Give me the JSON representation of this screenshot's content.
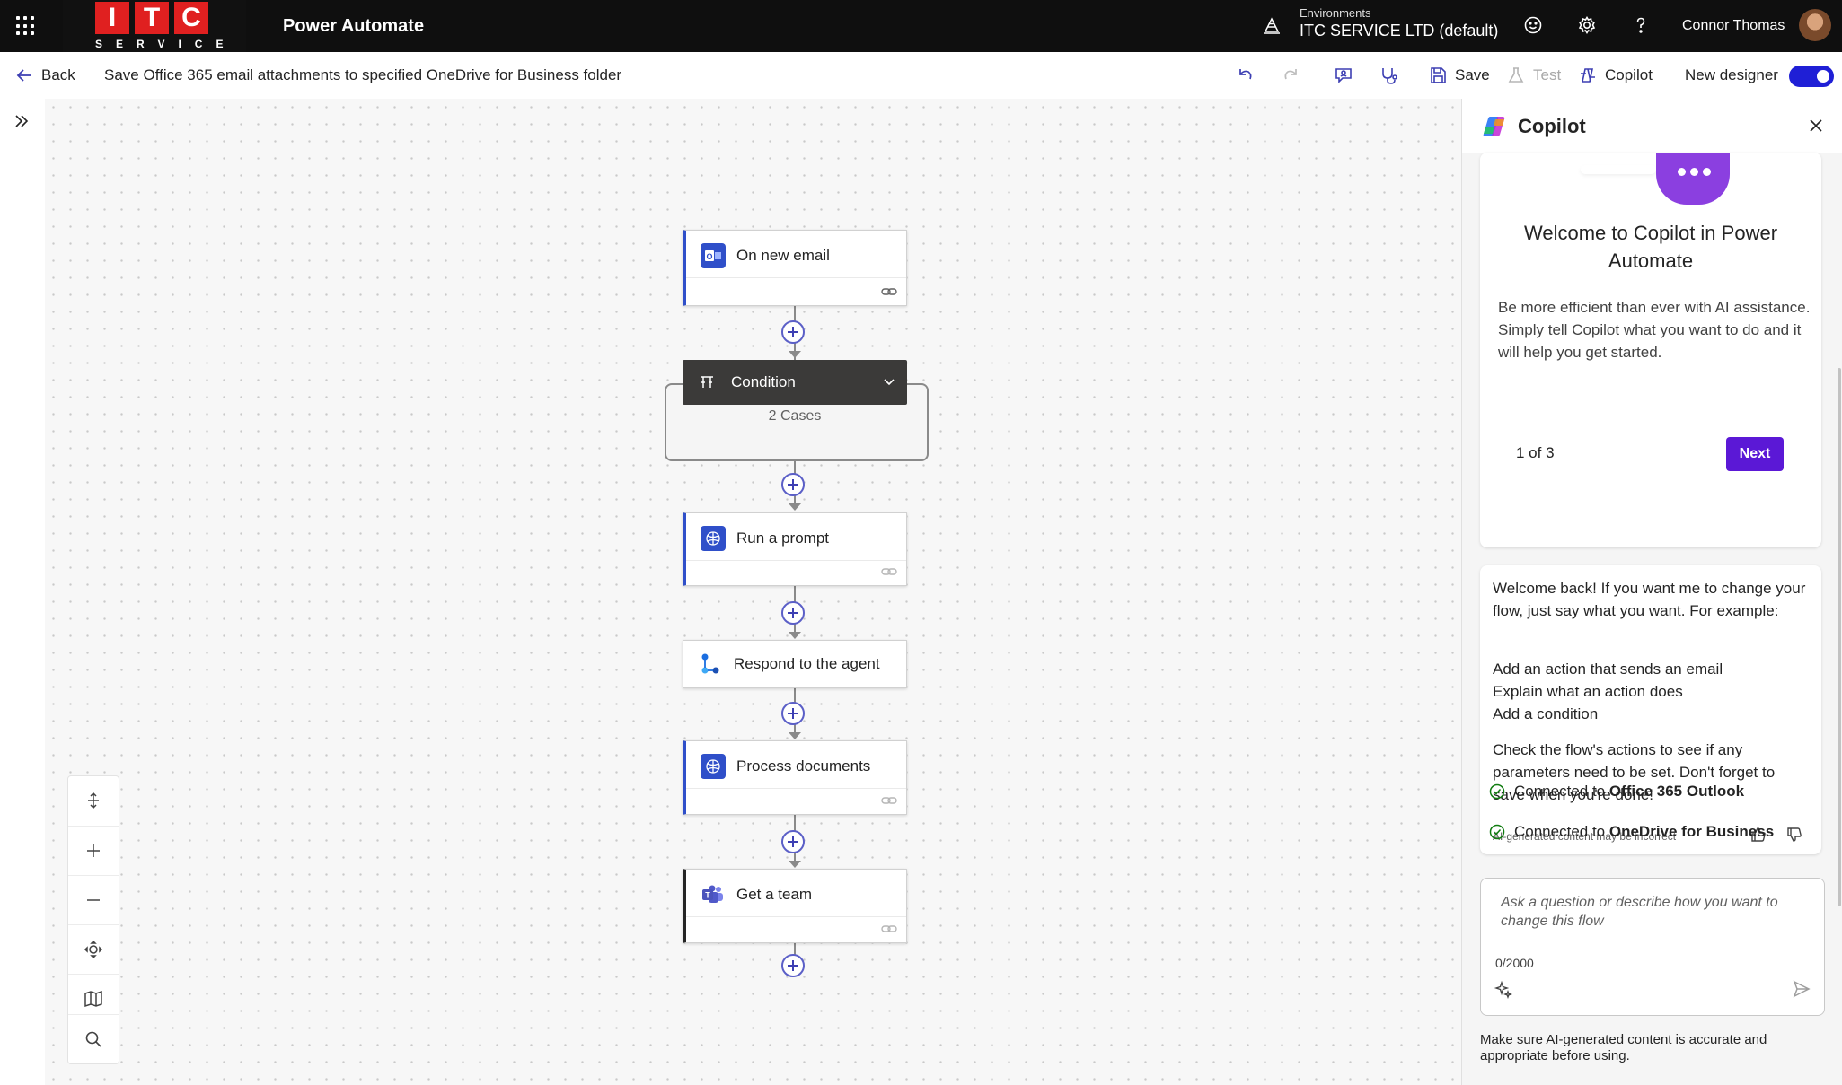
{
  "header": {
    "logo_letters": [
      "I",
      "T",
      "C"
    ],
    "logo_sub": "SERVICE",
    "app_name": "Power Automate",
    "env_label": "Environments",
    "env_name": "ITC SERVICE LTD (default)",
    "user_name": "Connor Thomas"
  },
  "command_bar": {
    "back_label": "Back",
    "flow_title": "Save Office 365 email attachments to specified OneDrive for Business folder",
    "save_label": "Save",
    "test_label": "Test",
    "copilot_label": "Copilot",
    "new_designer_label": "New designer",
    "new_designer_on": true
  },
  "flow": {
    "trigger": {
      "label": "On new email",
      "icon": "outlook-icon",
      "color": "#2f4fc9"
    },
    "condition": {
      "label": "Condition",
      "cases": "2 Cases"
    },
    "steps": [
      {
        "label": "Run a prompt",
        "icon": "ai-prompt-icon"
      },
      {
        "label": "Respond to the agent",
        "icon": "agent-icon"
      },
      {
        "label": "Process documents",
        "icon": "ai-prompt-icon"
      },
      {
        "label": "Get a team",
        "icon": "teams-icon"
      }
    ]
  },
  "copilot": {
    "title": "Copilot",
    "welcome_title": "Welcome to Copilot in Power Automate",
    "welcome_body": "Be more efficient than ever with AI assistance. Simply tell Copilot what you want to do and it will help you get started.",
    "pager": "1 of 3",
    "next_label": "Next",
    "message_intro": "Welcome back! If you want me to change your flow, just say what you want. For example:",
    "examples": [
      "Add an action that sends an email",
      "Explain what an action does",
      "Add a condition"
    ],
    "message_outro": "Check the flow's actions to see if any parameters need to be set. Don't forget to save when you're done!",
    "disclaimer": "AI-generated content may be incorrect",
    "connections": [
      {
        "prefix": "Connected to",
        "name": "Office 365 Outlook"
      },
      {
        "prefix": "Connected to",
        "name": "OneDrive for Business"
      }
    ],
    "input_placeholder": "Ask a question or describe how you want to change this flow",
    "char_count": "0/2000",
    "footnote": "Make sure AI-generated content is accurate and appropriate before using."
  }
}
